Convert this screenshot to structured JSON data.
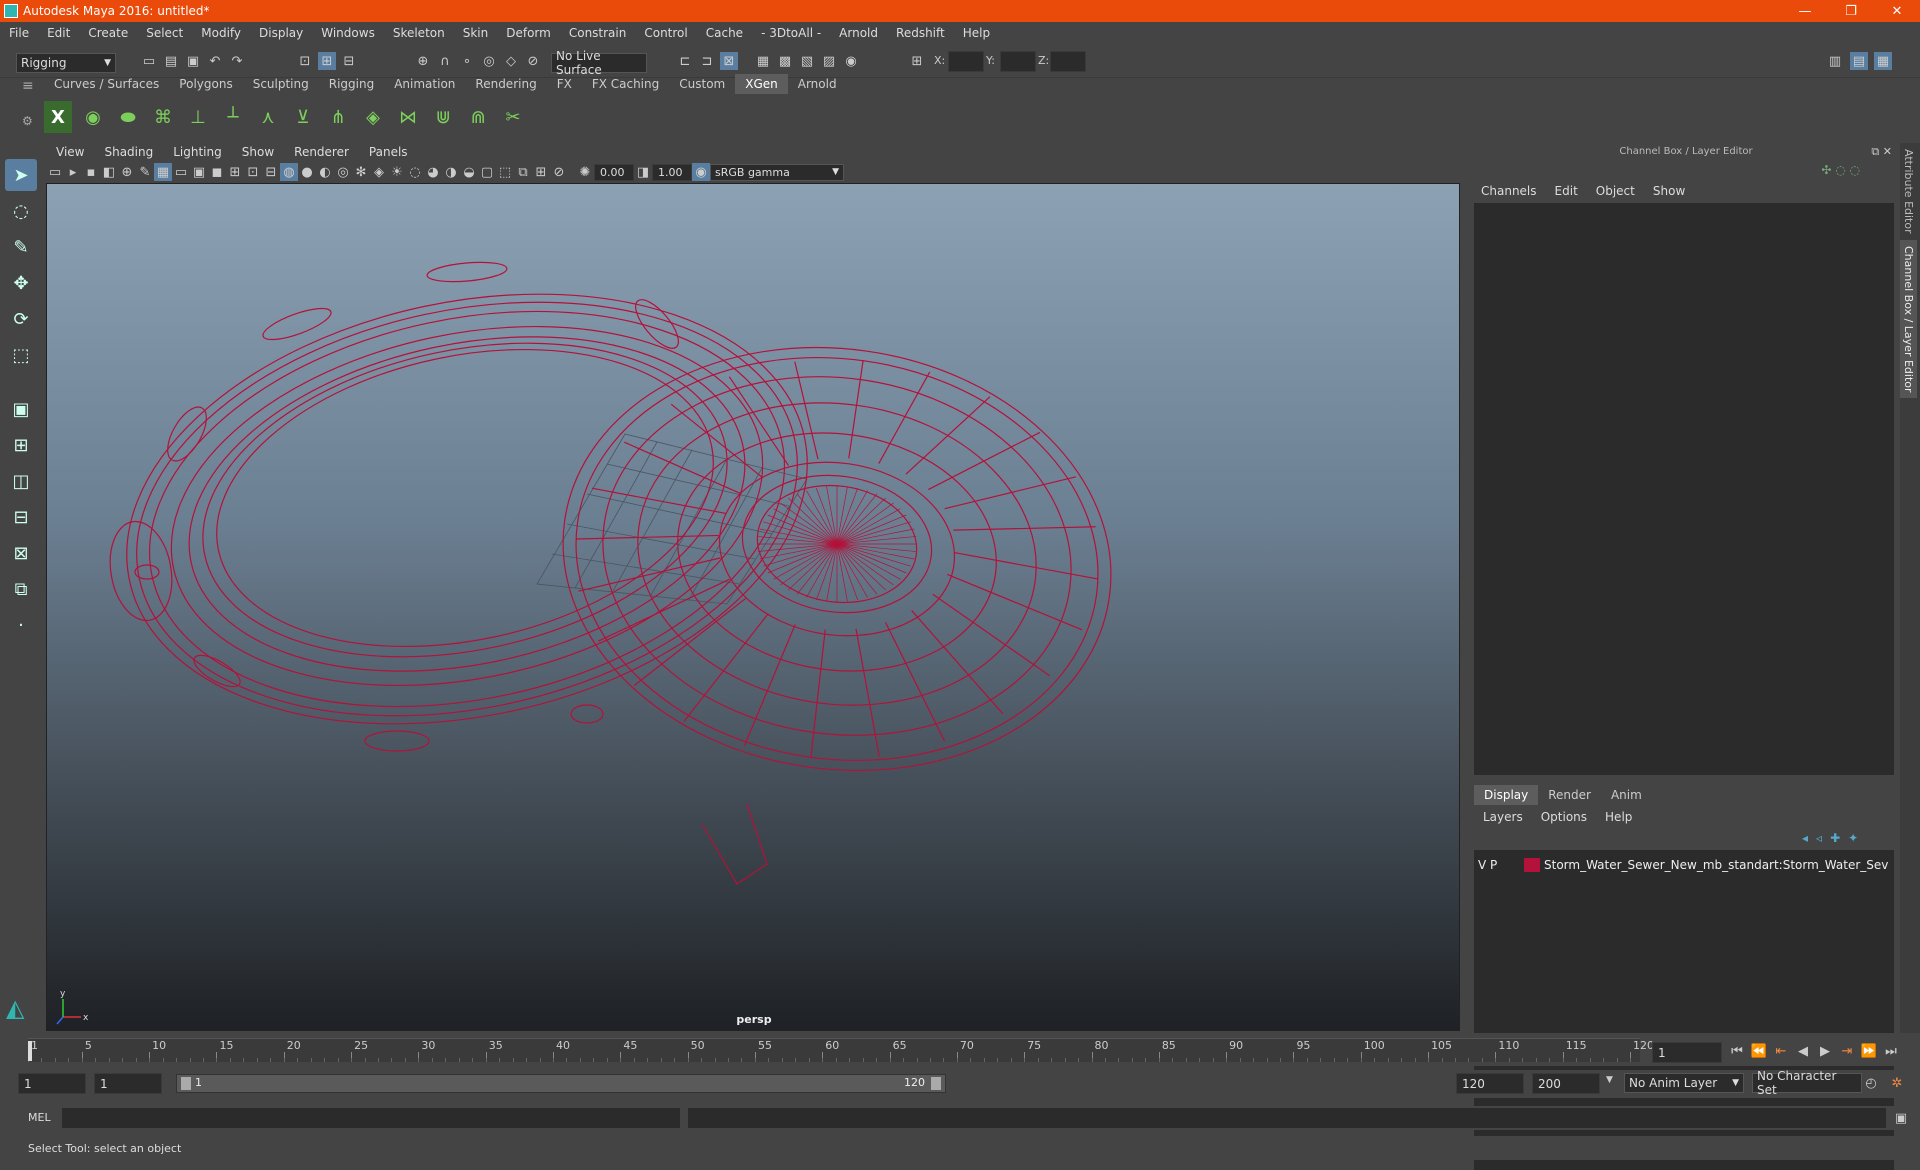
{
  "window": {
    "title": "Autodesk Maya 2016: untitled*",
    "minimize": "—",
    "maximize": "❐",
    "close": "✕"
  },
  "menus": [
    "File",
    "Edit",
    "Create",
    "Select",
    "Modify",
    "Display",
    "Windows",
    "Skeleton",
    "Skin",
    "Deform",
    "Constrain",
    "Control",
    "Cache",
    "- 3DtoAll -",
    "Arnold",
    "Redshift",
    "Help"
  ],
  "statusline": {
    "mode": "Rigging",
    "live_surface": "No Live Surface",
    "x_label": "X:",
    "y_label": "Y:",
    "z_label": "Z:"
  },
  "shelf": {
    "tabs": [
      "Curves / Surfaces",
      "Polygons",
      "Sculpting",
      "Rigging",
      "Animation",
      "Rendering",
      "FX",
      "FX Caching",
      "Custom",
      "XGen",
      "Arnold"
    ],
    "active_tab": "XGen"
  },
  "viewport": {
    "menus": [
      "View",
      "Shading",
      "Lighting",
      "Show",
      "Renderer",
      "Panels"
    ],
    "exposure": "0.00",
    "gamma": "1.00",
    "color_space": "sRGB gamma",
    "camera_label": "persp",
    "axis_x": "x",
    "axis_y": "y",
    "wire_color": "#b3123a"
  },
  "channelbox": {
    "title": "Channel Box / Layer Editor",
    "menus": [
      "Channels",
      "Edit",
      "Object",
      "Show"
    ],
    "layer_tabs": [
      "Display",
      "Render",
      "Anim"
    ],
    "active_layer_tab": "Display",
    "layer_menus": [
      "Layers",
      "Options",
      "Help"
    ],
    "layer": {
      "v": "V",
      "p": "P",
      "name": "Storm_Water_Sewer_New_mb_standart:Storm_Water_Sev",
      "color": "#b3123a"
    }
  },
  "side_tabs": [
    "Attribute Editor",
    "Channel Box / Layer Editor"
  ],
  "timeline": {
    "current_frame": "1",
    "ticks": [
      "1",
      "5",
      "10",
      "15",
      "20",
      "25",
      "30",
      "35",
      "40",
      "45",
      "50",
      "55",
      "60",
      "65",
      "70",
      "75",
      "80",
      "85",
      "90",
      "95",
      "100",
      "105",
      "110",
      "115",
      "120"
    ],
    "frame_field": "1"
  },
  "range": {
    "start": "1",
    "playback_start": "1",
    "slider_start": "1",
    "slider_end": "120",
    "playback_end": "120",
    "end": "200",
    "anim_layer": "No Anim Layer",
    "character_set": "No Character Set"
  },
  "cmdline": {
    "label": "MEL"
  },
  "helpline": {
    "text": "Select Tool: select an object"
  }
}
